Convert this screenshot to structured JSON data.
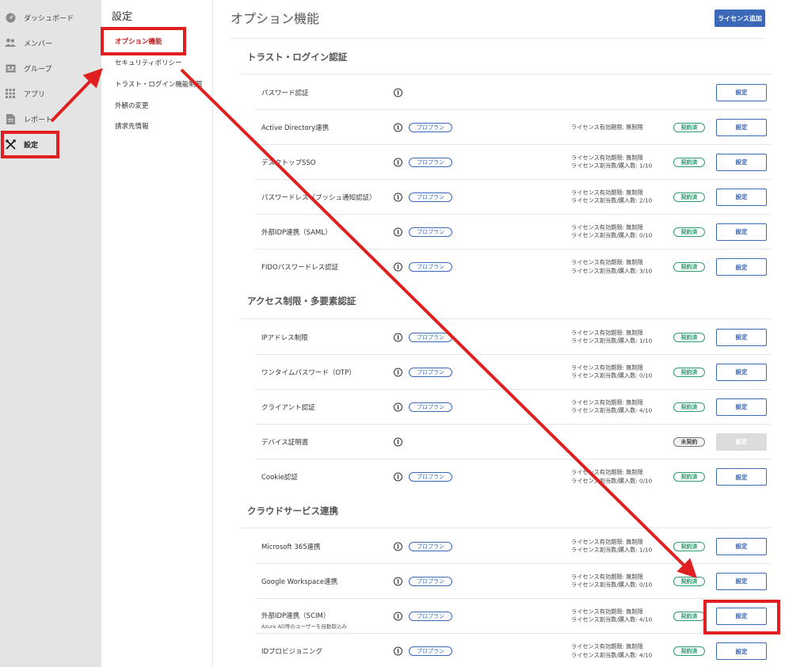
{
  "sidebar": {
    "items": [
      {
        "label": "ダッシュボード",
        "icon": "dashboard-icon"
      },
      {
        "label": "メンバー",
        "icon": "members-icon"
      },
      {
        "label": "グループ",
        "icon": "group-icon"
      },
      {
        "label": "アプリ",
        "icon": "apps-grid-icon"
      },
      {
        "label": "レポート",
        "icon": "report-icon"
      },
      {
        "label": "設定",
        "icon": "settings-tools-icon"
      }
    ]
  },
  "subnav": {
    "title": "設定",
    "items": [
      {
        "label": "オプション機能"
      },
      {
        "label": "セキュリティポリシー"
      },
      {
        "label": "トラスト・ログイン機能制限"
      },
      {
        "label": "外観の変更"
      },
      {
        "label": "請求先情報"
      }
    ]
  },
  "main": {
    "title": "オプション機能",
    "license_button": "ライセンス追加",
    "info_glyph": "i",
    "sections": [
      {
        "title": "トラスト・ログイン認証"
      },
      {
        "title": "アクセス制限・多要素認証"
      },
      {
        "title": "クラウドサービス連携"
      }
    ],
    "rows": [
      {
        "name": "パスワード認証",
        "pro": "",
        "lic1": "",
        "lic2": "",
        "status": "",
        "button": "設定"
      },
      {
        "name": "Active Directory連携",
        "pro": "プロプラン",
        "lic1": "ライセンス有効期限: 無制限",
        "lic2": "",
        "status": "契約済",
        "button": "設定"
      },
      {
        "name": "デスクトップSSO",
        "pro": "プロプラン",
        "lic1": "ライセンス有効期限: 無制限",
        "lic2": "ライセンス割当数/購入数: 1/10",
        "status": "契約済",
        "button": "設定"
      },
      {
        "name": "パスワードレス（プッシュ通知認証）",
        "pro": "プロプラン",
        "lic1": "ライセンス有効期限: 無制限",
        "lic2": "ライセンス割当数/購入数: 2/10",
        "status": "契約済",
        "button": "設定"
      },
      {
        "name": "外部IDP連携（SAML）",
        "pro": "プロプラン",
        "lic1": "ライセンス有効期限: 無制限",
        "lic2": "ライセンス割当数/購入数: 0/10",
        "status": "契約済",
        "button": "設定"
      },
      {
        "name": "FIDOパスワードレス認証",
        "pro": "プロプラン",
        "lic1": "ライセンス有効期限: 無制限",
        "lic2": "ライセンス割当数/購入数: 3/10",
        "status": "契約済",
        "button": "設定"
      },
      {
        "name": "IPアドレス制限",
        "pro": "プロプラン",
        "lic1": "ライセンス有効期限: 無制限",
        "lic2": "ライセンス割当数/購入数: 1/10",
        "status": "契約済",
        "button": "設定"
      },
      {
        "name": "ワンタイムパスワード（OTP）",
        "pro": "プロプラン",
        "lic1": "ライセンス有効期限: 無制限",
        "lic2": "ライセンス割当数/購入数: 0/10",
        "status": "契約済",
        "button": "設定"
      },
      {
        "name": "クライアント認証",
        "pro": "プロプラン",
        "lic1": "ライセンス有効期限: 無制限",
        "lic2": "ライセンス割当数/購入数: 4/10",
        "status": "契約済",
        "button": "設定"
      },
      {
        "name": "デバイス証明書",
        "pro": "",
        "lic1": "",
        "lic2": "",
        "status": "未契約",
        "button": "設定"
      },
      {
        "name": "Cookie認証",
        "pro": "プロプラン",
        "lic1": "ライセンス有効期限: 無制限",
        "lic2": "ライセンス割当数/購入数: 0/10",
        "status": "契約済",
        "button": "設定"
      },
      {
        "name": "Microsoft 365連携",
        "pro": "プロプラン",
        "lic1": "ライセンス有効期限: 無制限",
        "lic2": "ライセンス割当数/購入数: 1/10",
        "status": "契約済",
        "button": "設定"
      },
      {
        "name": "Google Workspace連携",
        "pro": "プロプラン",
        "lic1": "ライセンス有効期限: 無制限",
        "lic2": "ライセンス割当数/購入数: 0/10",
        "status": "契約済",
        "button": "設定"
      },
      {
        "name": "外部IDP連携（SCIM）",
        "sub": "Azure AD等のユーザーを自動取込み",
        "pro": "プロプラン",
        "lic1": "ライセンス有効期限: 無制限",
        "lic2": "ライセンス割当数/購入数: 4/10",
        "status": "契約済",
        "button": "設定"
      },
      {
        "name": "IDプロビジョニング",
        "pro": "プロプラン",
        "lic1": "ライセンス有効期限: 無制限",
        "lic2": "ライセンス割当数/購入数: 4/10",
        "status": "契約済",
        "button": "設定"
      }
    ]
  },
  "colors": {
    "sidebar_bg": "#e4e4e4",
    "primary": "#3b68b8",
    "contracted": "#2e9c6e",
    "annotation_red": "#e02020"
  }
}
